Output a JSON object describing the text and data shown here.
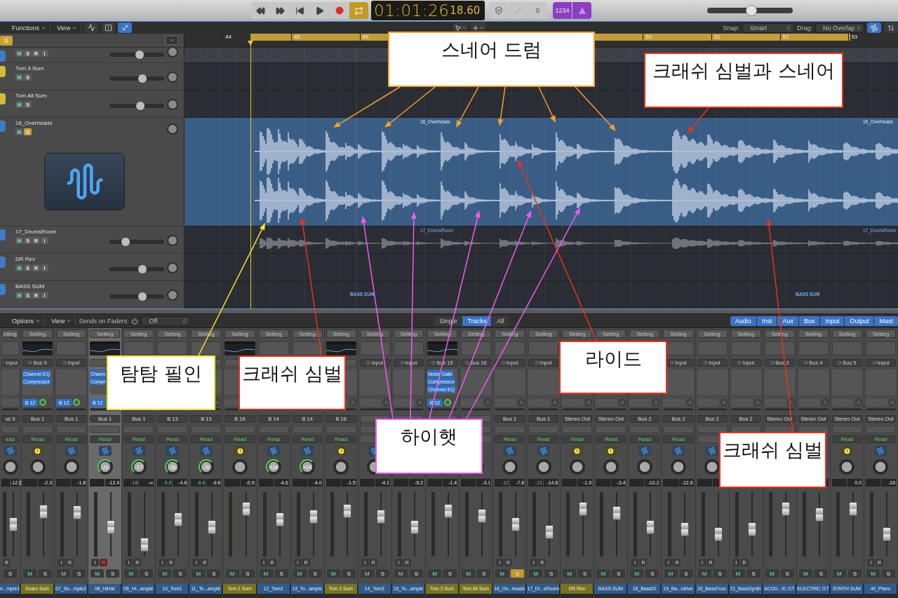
{
  "transport": {
    "timecode": "01:01:26",
    "subframes": "18.60",
    "cycle_on": true,
    "solo_key": "S",
    "count_in": "1234"
  },
  "master_volume": {
    "level": 0.52
  },
  "toolbar": {
    "menus": [
      "Functions",
      "View"
    ],
    "snap_label": "Snap:",
    "snap": "Smart",
    "drag_label": "Drag:",
    "drag": "No Overlap"
  },
  "global_solo": "S",
  "ruler": {
    "first": [
      "44",
      "45",
      "46"
    ],
    "second": [
      "50",
      "51",
      "52",
      "53"
    ]
  },
  "tracks": [
    {
      "kind": "partial",
      "aux": false,
      "buttons": [
        "M",
        "S",
        "R",
        "I"
      ],
      "soloed": false,
      "level": 0.55
    },
    {
      "kind": "normal",
      "aux": true,
      "name": "Tom 3 Sum",
      "buttons": [
        "M",
        "S"
      ],
      "soloed": false,
      "level": 0.6
    },
    {
      "kind": "normal",
      "aux": true,
      "name": "Tom All Sum",
      "buttons": [
        "M",
        "S"
      ],
      "soloed": false,
      "level": 0.56
    },
    {
      "kind": "large",
      "aux": false,
      "name": "16_Overheads",
      "buttons": [
        "M",
        "S"
      ],
      "soloed": true,
      "lane": {
        "kind": "region",
        "labels": [
          "16_Overheads",
          "16_Overheads"
        ]
      }
    },
    {
      "kind": "normal",
      "aux": false,
      "name": "17_DrumsRoom",
      "buttons": [
        "M",
        "S",
        "R",
        "I"
      ],
      "soloed": false,
      "level": 0.3,
      "lane": {
        "kind": "wave",
        "labels": [
          "17_DrumsRoom",
          "17_DrumsRoom"
        ]
      }
    },
    {
      "kind": "normal",
      "aux": false,
      "name": "DR Rev",
      "buttons": [
        "M",
        "S",
        "R",
        "I"
      ],
      "soloed": false,
      "level": 0.6
    },
    {
      "kind": "normal",
      "aux": false,
      "name": "BASS SUM",
      "buttons": [
        "M",
        "S",
        "R",
        "I"
      ],
      "soloed": false,
      "level": 0.6,
      "lane": {
        "kind": "labels",
        "labels": [
          "BASS SUM",
          "BASS SUM"
        ]
      }
    }
  ],
  "mixer": {
    "menus": [
      "Options",
      "View"
    ],
    "sends_label": "Sends on Faders:",
    "sends_value": "Off",
    "views": [
      {
        "label": "Single",
        "selected": false
      },
      {
        "label": "Tracks",
        "selected": true
      },
      {
        "label": "All",
        "selected": false
      }
    ],
    "filters": [
      {
        "label": "Audio",
        "selected": true
      },
      {
        "label": "Inst",
        "selected": true
      },
      {
        "label": "Aux",
        "selected": true
      },
      {
        "label": "Bus",
        "selected": true
      },
      {
        "label": "Input",
        "selected": true
      },
      {
        "label": "Output",
        "selected": true
      },
      {
        "label": "Mast",
        "selected": true
      }
    ],
    "strips": [
      {
        "partial": true,
        "kind": "audio",
        "name": "n...mple1",
        "setting": "etting",
        "eq": false,
        "input": "Input",
        "output": "us 9",
        "automation": "ead",
        "level_text": "-12.2",
        "level": 0.5,
        "ir": [
          "R"
        ],
        "solo": "S",
        "soloed": false,
        "armed": false,
        "selected": false
      },
      {
        "partial": false,
        "kind": "aux",
        "name": "Snare Sum",
        "setting": "Setting",
        "eq": true,
        "input": "Bus 9",
        "plugins": [
          "Channel EQ",
          "Compressor"
        ],
        "send": "B 12",
        "output": "Bus 1",
        "automation": "Read",
        "level_text": "-2.3",
        "level": 0.75,
        "mute": "M",
        "solo": "S",
        "soloed": false,
        "selected": false
      },
      {
        "partial": false,
        "kind": "audio",
        "name": "07_Sn...mple2",
        "setting": "Setting",
        "eq": false,
        "input": "Input",
        "send": "B 12",
        "output": "Bus 1",
        "automation": "Read",
        "level_text": "-1.8",
        "level": 0.74,
        "ir": [
          "I",
          "R"
        ],
        "mute": "M",
        "solo": "S",
        "soloed": false,
        "armed": false,
        "selected": false
      },
      {
        "partial": false,
        "kind": "audio",
        "name": "08_HiHat",
        "setting": "Setting",
        "eq": true,
        "plugins": [
          "Chann",
          "Compr"
        ],
        "send": "B 12",
        "output": "Bus 1",
        "automation": "Read",
        "pan": "-21",
        "level_text": "-12.4",
        "level": 0.45,
        "ir": [
          "I",
          "R"
        ],
        "mute": "M",
        "solo": "S",
        "soloed": false,
        "armed": true,
        "selected": true
      },
      {
        "partial": false,
        "kind": "audio",
        "name": "09_Hi...ample",
        "setting": "Setting",
        "eq": false,
        "output": "Bus 1",
        "automation": "Read",
        "pan": "-17",
        "peak": "-18",
        "level_text": "-∞",
        "level": 0.1,
        "ir": [
          "I",
          "R"
        ],
        "mute": "M",
        "solo": "S",
        "soloed": false,
        "armed": false,
        "selected": false
      },
      {
        "partial": false,
        "kind": "audio",
        "name": "10_Tom1",
        "setting": "Setting",
        "eq": false,
        "output": "B 13",
        "automation": "Read",
        "pan": "-36",
        "peak": "-5.5",
        "level_text": "-4.6",
        "level": 0.6,
        "ir": [
          "I",
          "R"
        ],
        "mute": "M",
        "solo": "S",
        "soloed": false,
        "armed": false,
        "selected": false
      },
      {
        "partial": false,
        "kind": "audio",
        "name": "11_To...ample",
        "setting": "Setting",
        "eq": false,
        "output": "B 13",
        "automation": "Read",
        "pan": "-35",
        "peak": "-8.6",
        "level_text": "-9.6",
        "level": 0.45,
        "ir": [
          "I",
          "R"
        ],
        "mute": "M",
        "solo": "S",
        "soloed": false,
        "armed": false,
        "selected": false
      },
      {
        "partial": false,
        "kind": "aux",
        "name": "Tom 1 Sum",
        "setting": "Setting",
        "eq": true,
        "output": "B 16",
        "automation": "Read",
        "level_text": "-0.9",
        "level": 0.8,
        "mute": "M",
        "solo": "S",
        "soloed": false,
        "selected": false
      },
      {
        "partial": false,
        "kind": "audio",
        "name": "12_Tom2",
        "setting": "Setting",
        "eq": false,
        "output": "B 14",
        "automation": "Read",
        "pan": "+24",
        "level_text": "-4.6",
        "level": 0.6,
        "ir": [
          "I",
          "R"
        ],
        "mute": "M",
        "solo": "S",
        "soloed": false,
        "armed": false,
        "selected": false
      },
      {
        "partial": false,
        "kind": "audio",
        "name": "13_To...ample",
        "setting": "Setting",
        "eq": false,
        "output": "B 14",
        "automation": "Read",
        "pan": "+24",
        "level_text": "-4.0",
        "level": 0.65,
        "ir": [
          "I",
          "R"
        ],
        "mute": "M",
        "solo": "S",
        "soloed": false,
        "armed": false,
        "selected": false
      },
      {
        "partial": false,
        "kind": "aux",
        "name": "Tom 2 Sum",
        "setting": "Setting",
        "eq": true,
        "output": "B 16",
        "automation": "Read",
        "level_text": "-1.5",
        "level": 0.76,
        "mute": "M",
        "solo": "S",
        "soloed": false,
        "selected": false
      },
      {
        "partial": false,
        "kind": "audio",
        "name": "14_Tom3",
        "setting": "Setting",
        "eq": false,
        "input": "Input",
        "level_text": "-4.1",
        "level": 0.65,
        "ir": [
          "I",
          "R"
        ],
        "mute": "M",
        "solo": "S",
        "soloed": false,
        "armed": false,
        "selected": false
      },
      {
        "partial": false,
        "kind": "audio",
        "name": "15_To...ample",
        "setting": "Setting",
        "eq": false,
        "input": "Input",
        "level_text": "-9.2",
        "level": 0.45,
        "ir": [
          "I",
          "R"
        ],
        "mute": "M",
        "solo": "S",
        "soloed": false,
        "armed": false,
        "selected": false
      },
      {
        "partial": false,
        "kind": "aux",
        "name": "Tom 3 Sum",
        "setting": "Setting",
        "eq": true,
        "input": "Bus 15",
        "plugins": [
          "Noise Gate",
          "Compressor",
          "Channel EQ"
        ],
        "send": "B 12",
        "level_text": "-1.4",
        "level": 0.76,
        "mute": "M",
        "solo": "S",
        "soloed": false,
        "selected": false
      },
      {
        "partial": false,
        "kind": "aux",
        "name": "Tom All Sum",
        "setting": "Setting",
        "eq": false,
        "input": "Bus 16",
        "level_text": "-3.1",
        "level": 0.66,
        "mute": "M",
        "solo": "S",
        "soloed": false,
        "selected": false
      },
      {
        "partial": false,
        "kind": "audio",
        "name": "16_Ov...heads",
        "setting": "Setting",
        "eq": false,
        "input": "Input",
        "output": "Bus 1",
        "automation": "Read",
        "peak": "-12",
        "level_text": "-7.8",
        "level": 0.5,
        "ir": [
          "I",
          "R"
        ],
        "mute": "M",
        "solo": "S",
        "soloed": true,
        "armed": false,
        "selected": false
      },
      {
        "partial": false,
        "kind": "audio",
        "name": "17_Dr...sRoom",
        "setting": "Setting",
        "eq": false,
        "input": "Input",
        "output": "Bus 1",
        "automation": "Read",
        "peak": "-21",
        "level_text": "-14.8",
        "level": 0.35,
        "ir": [
          "I",
          "R"
        ],
        "mute": "M",
        "solo": "S",
        "soloed": false,
        "armed": false,
        "selected": false
      },
      {
        "partial": false,
        "kind": "aux",
        "name": "DR Rev",
        "setting": "Setting",
        "output": "Stereo Out",
        "automation": "Read",
        "level_text": "-1.0",
        "level": 0.8,
        "mute": "M",
        "solo": "S",
        "soloed": false,
        "selected": false
      },
      {
        "partial": false,
        "kind": "bus",
        "name": "BASS SUM",
        "setting": "Setting",
        "output": "Stereo Out",
        "automation": "Read",
        "level_text": "-3.4",
        "level": 0.72,
        "mute": "M",
        "solo": "S",
        "soloed": false,
        "selected": false
      },
      {
        "partial": false,
        "kind": "audio",
        "name": "18_BassDI",
        "setting": "Setting",
        "output": "Bus 2",
        "automation": "Read",
        "level_text": "-10.2",
        "level": 0.45,
        "ir": [
          "I",
          "R"
        ],
        "mute": "M",
        "solo": "S",
        "soloed": false,
        "armed": false,
        "selected": false
      },
      {
        "partial": false,
        "kind": "audio",
        "name": "19_Ba...rdrive",
        "setting": "Setting",
        "eq": false,
        "input": "Input",
        "output": "Bus 2",
        "automation": "Read",
        "level_text": "-12.6",
        "level": 0.4,
        "ir": [
          "I",
          "R"
        ],
        "mute": "M",
        "solo": "S",
        "soloed": false,
        "armed": false,
        "selected": false
      },
      {
        "partial": false,
        "kind": "audio",
        "name": "20_BassFuzz",
        "setting": "Setting",
        "eq": false,
        "input": "Input",
        "output": "Bus 2",
        "level": 0.3,
        "ir": [
          "I",
          "R"
        ],
        "mute": "M",
        "solo": "S",
        "soloed": false,
        "armed": false,
        "selected": false
      },
      {
        "partial": false,
        "kind": "audio",
        "name": "21_BassSynth",
        "setting": "Setting",
        "eq": false,
        "input": "Input",
        "output": "Bus 2",
        "level": 0.4,
        "ir": [
          "I",
          "R"
        ],
        "mute": "M",
        "solo": "S",
        "soloed": false,
        "armed": false,
        "selected": false
      },
      {
        "partial": false,
        "kind": "audio",
        "name": "ACOU...IC GT",
        "setting": "Setting",
        "eq": false,
        "input": "Bus 3",
        "output": "Stereo Out",
        "level": 0.8,
        "mute": "M",
        "solo": "S",
        "soloed": false,
        "selected": false
      },
      {
        "partial": false,
        "kind": "audio",
        "name": "ELECTRIC GT",
        "setting": "Setting",
        "eq": false,
        "input": "Bus 4",
        "output": "Stereo Out",
        "level": 0.7,
        "mute": "M",
        "solo": "S",
        "soloed": false,
        "selected": false
      },
      {
        "partial": false,
        "kind": "bus",
        "name": "SYNTH SUM",
        "setting": "Setting",
        "eq": false,
        "input": "Bus 5",
        "output": "Stereo Out",
        "automation": "Read",
        "level_text": "0.0",
        "level": 0.8,
        "mute": "M",
        "solo": "S",
        "soloed": false,
        "selected": false
      },
      {
        "partial": false,
        "kind": "audio",
        "name": "40_Piano",
        "setting": "Setting",
        "eq": false,
        "input": "Input",
        "output": "Stereo Out",
        "automation": "Read",
        "level_text": "-16",
        "level": 0.3,
        "ir": [
          "I",
          "R"
        ],
        "mute": "M",
        "solo": "S",
        "soloed": false,
        "armed": false,
        "selected": false
      }
    ]
  },
  "callouts": [
    {
      "text": "스네어 드럼",
      "color": "#f5a02e"
    },
    {
      "text": "크래쉬 심벌과 스네어",
      "color": "#e8321e"
    },
    {
      "text": "라이드",
      "color": "#e8321e"
    },
    {
      "text": "탐탐 필인",
      "color": "#f0e62a"
    },
    {
      "text": "크래쉬 심벌",
      "color": "#e8321e"
    },
    {
      "text": "하이햇",
      "color": "#ef5cf0"
    },
    {
      "text": "크래쉬 심벌",
      "color": "#e8321e"
    }
  ]
}
